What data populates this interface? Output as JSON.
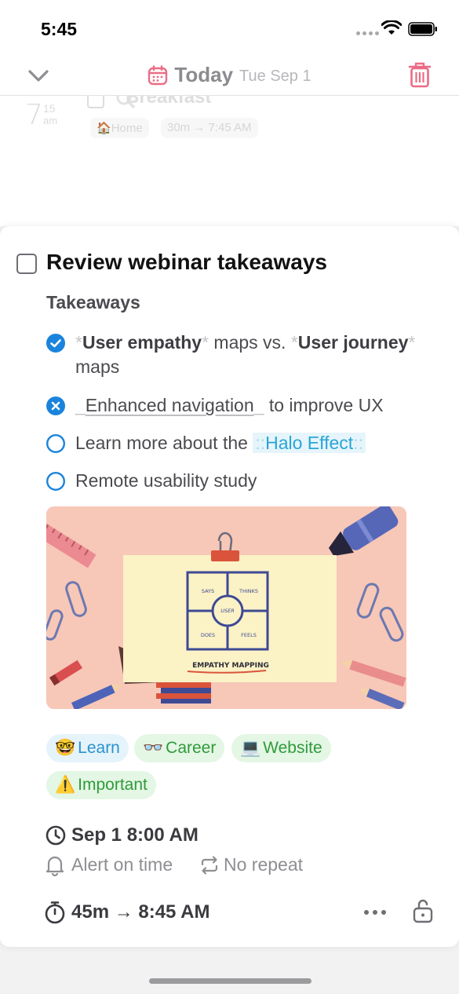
{
  "status_bar": {
    "time": "5:45"
  },
  "header": {
    "title": "Today",
    "date": "Tue Sep 1"
  },
  "background_task": {
    "hour": "7",
    "minute": "15",
    "ampm": "am",
    "title": "Breakfast",
    "location": "Home",
    "duration": "30m → 7:45 AM"
  },
  "task": {
    "title": "Review webinar takeaways",
    "section_heading": "Takeaways",
    "todos": [
      {
        "state": "checked",
        "parts": [
          "*",
          "User empathy",
          "*",
          " maps vs. ",
          "*",
          "User journey",
          "*",
          " maps"
        ]
      },
      {
        "state": "cancelled",
        "prefix": "_",
        "underlined": "Enhanced navigation",
        "suffix_mark": "_",
        "rest": " to improve UX"
      },
      {
        "state": "open",
        "text": "Learn more about the ",
        "highlight_mark_l": "::",
        "highlight": "Halo Effect",
        "highlight_mark_r": "::"
      },
      {
        "state": "open",
        "text": "Remote usability study"
      }
    ],
    "illustration": {
      "cells": [
        "SAYS",
        "THINKS",
        "DOES",
        "FEELS"
      ],
      "center": "USER",
      "caption": "EMPATHY MAPPING"
    },
    "tags": [
      {
        "emoji": "🤓",
        "label": "Learn",
        "color": "blue"
      },
      {
        "emoji": "👓",
        "label": "Career",
        "color": "green"
      },
      {
        "emoji": "💻",
        "label": "Website",
        "color": "green"
      },
      {
        "emoji": "⚠️",
        "label": "Important",
        "color": "green"
      }
    ],
    "schedule": {
      "datetime": "Sep 1 8:00 AM",
      "alert": "Alert on time",
      "repeat": "No repeat"
    },
    "duration": "45m → 8:45 AM"
  },
  "colors": {
    "accent_blue": "#1a84dc",
    "trash_pink": "#ec6b86",
    "calendar_pink": "#ea6d85"
  }
}
